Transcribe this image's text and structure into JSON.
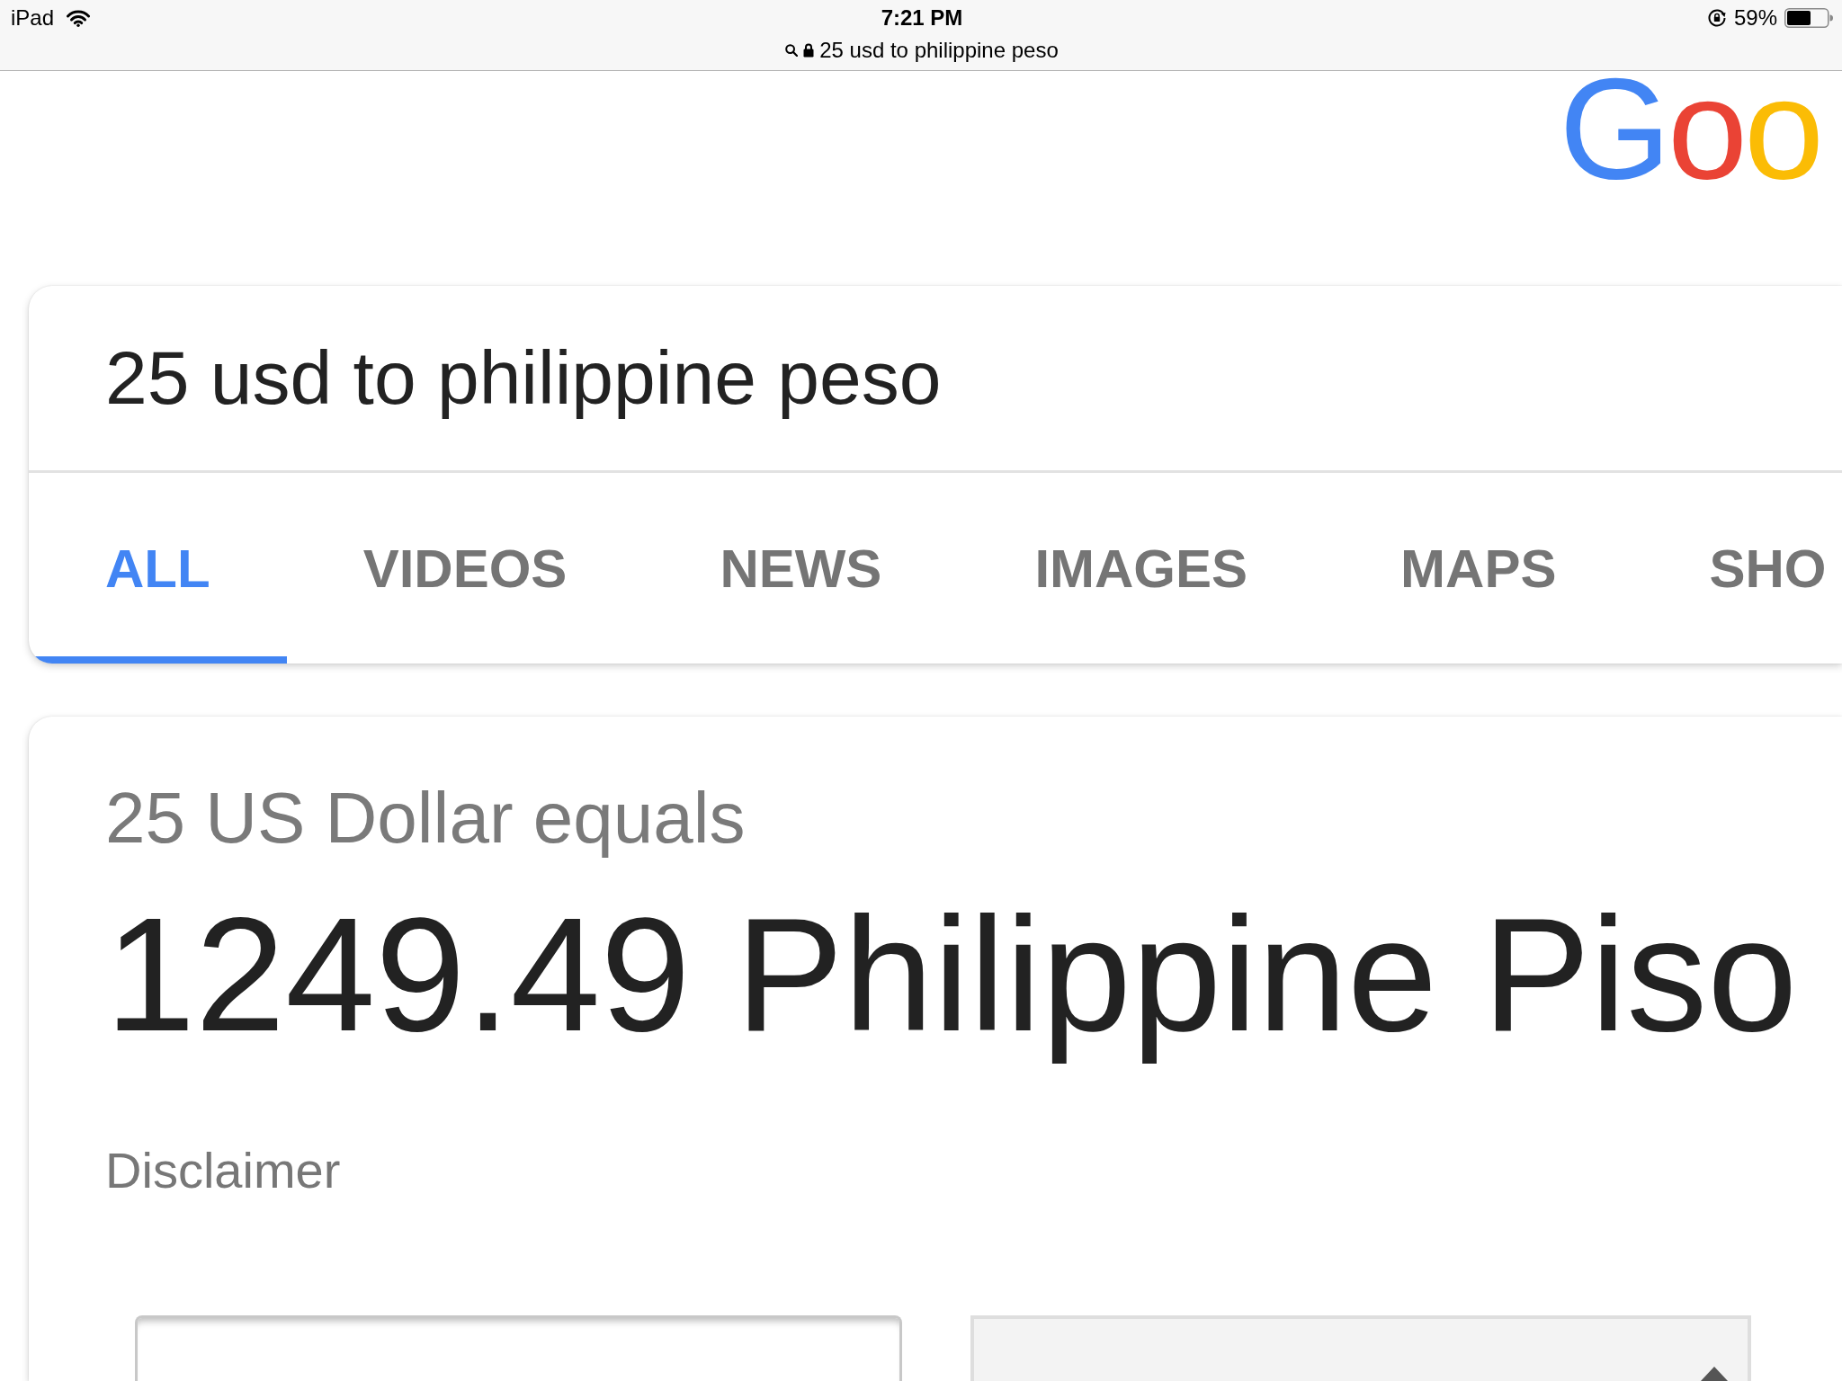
{
  "status_bar": {
    "device": "iPad",
    "time": "7:21 PM",
    "address": "25 usd to philippine peso",
    "battery": "59%"
  },
  "logo": {
    "letters": [
      {
        "text": "G",
        "color": "#4285f4"
      },
      {
        "text": "o",
        "color": "#ea4335"
      },
      {
        "text": "o",
        "color": "#fbbc05"
      }
    ]
  },
  "search": {
    "value": "25 usd to philippine peso"
  },
  "tabs": [
    {
      "label": "ALL",
      "selected": true
    },
    {
      "label": "VIDEOS",
      "selected": false
    },
    {
      "label": "NEWS",
      "selected": false
    },
    {
      "label": "IMAGES",
      "selected": false
    },
    {
      "label": "MAPS",
      "selected": false
    },
    {
      "label": "SHO",
      "selected": false
    }
  ],
  "result": {
    "caption": "25 US Dollar equals",
    "answer": "1249.49 Philippine Piso",
    "disclaimer": "Disclaimer"
  }
}
